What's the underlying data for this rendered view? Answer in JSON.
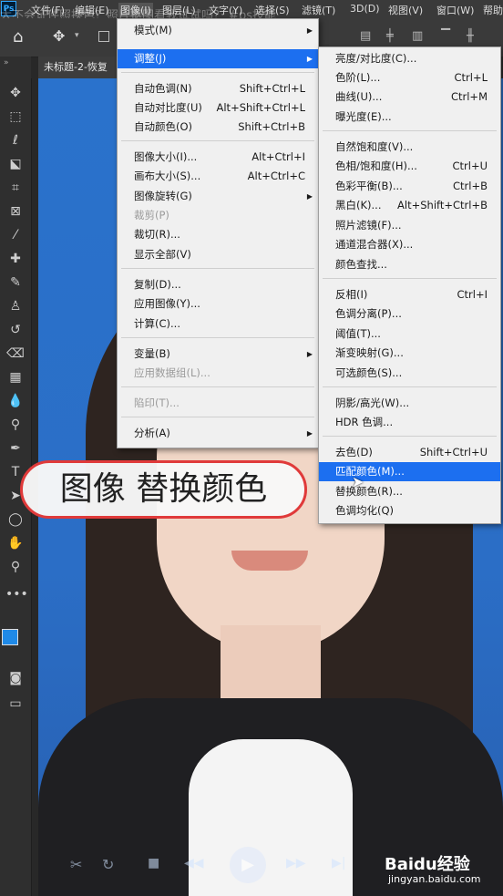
{
  "menubar": {
    "app_logo": "Ps",
    "overlay_caption": "大不会证件照换色？照片抠图看我试试吗？ #ps技能",
    "items": [
      "文件(F)",
      "编辑(E)",
      "图像(I)",
      "图层(L)",
      "文字(Y)",
      "选择(S)",
      "滤镜(T)",
      "3D(D)",
      "视图(V)",
      "窗口(W)",
      "帮助"
    ]
  },
  "tab": {
    "label": "未标题-2-恢复"
  },
  "image_menu": {
    "items": [
      {
        "label": "模式(M)",
        "shortcut": "",
        "submenu": true
      },
      {
        "label": "调整(J)",
        "shortcut": "",
        "submenu": true,
        "highlight": true
      },
      {
        "label": "自动色调(N)",
        "shortcut": "Shift+Ctrl+L"
      },
      {
        "label": "自动对比度(U)",
        "shortcut": "Alt+Shift+Ctrl+L"
      },
      {
        "label": "自动颜色(O)",
        "shortcut": "Shift+Ctrl+B"
      },
      {
        "label": "图像大小(I)...",
        "shortcut": "Alt+Ctrl+I"
      },
      {
        "label": "画布大小(S)...",
        "shortcut": "Alt+Ctrl+C"
      },
      {
        "label": "图像旋转(G)",
        "shortcut": "",
        "submenu": true
      },
      {
        "label": "裁剪(P)",
        "shortcut": "",
        "disabled": true
      },
      {
        "label": "裁切(R)...",
        "shortcut": ""
      },
      {
        "label": "显示全部(V)",
        "shortcut": ""
      },
      {
        "label": "复制(D)...",
        "shortcut": ""
      },
      {
        "label": "应用图像(Y)...",
        "shortcut": ""
      },
      {
        "label": "计算(C)...",
        "shortcut": ""
      },
      {
        "label": "变量(B)",
        "shortcut": "",
        "submenu": true
      },
      {
        "label": "应用数据组(L)...",
        "shortcut": "",
        "disabled": true
      },
      {
        "label": "陷印(T)...",
        "shortcut": "",
        "disabled": true
      },
      {
        "label": "分析(A)",
        "shortcut": "",
        "submenu": true
      }
    ]
  },
  "adjust_menu": {
    "items": [
      {
        "label": "亮度/对比度(C)...",
        "shortcut": ""
      },
      {
        "label": "色阶(L)...",
        "shortcut": "Ctrl+L"
      },
      {
        "label": "曲线(U)...",
        "shortcut": "Ctrl+M"
      },
      {
        "label": "曝光度(E)...",
        "shortcut": ""
      },
      {
        "label": "自然饱和度(V)...",
        "shortcut": ""
      },
      {
        "label": "色相/饱和度(H)...",
        "shortcut": "Ctrl+U"
      },
      {
        "label": "色彩平衡(B)...",
        "shortcut": "Ctrl+B"
      },
      {
        "label": "黑白(K)...",
        "shortcut": "Alt+Shift+Ctrl+B"
      },
      {
        "label": "照片滤镜(F)...",
        "shortcut": ""
      },
      {
        "label": "通道混合器(X)...",
        "shortcut": ""
      },
      {
        "label": "颜色查找...",
        "shortcut": ""
      },
      {
        "label": "反相(I)",
        "shortcut": "Ctrl+I"
      },
      {
        "label": "色调分离(P)...",
        "shortcut": ""
      },
      {
        "label": "阈值(T)...",
        "shortcut": ""
      },
      {
        "label": "渐变映射(G)...",
        "shortcut": ""
      },
      {
        "label": "可选颜色(S)...",
        "shortcut": ""
      },
      {
        "label": "阴影/高光(W)...",
        "shortcut": ""
      },
      {
        "label": "HDR 色调...",
        "shortcut": ""
      },
      {
        "label": "去色(D)",
        "shortcut": "Shift+Ctrl+U"
      },
      {
        "label": "匹配颜色(M)...",
        "shortcut": "",
        "highlight": true
      },
      {
        "label": "替换颜色(R)...",
        "shortcut": ""
      },
      {
        "label": "色调均化(Q)",
        "shortcut": ""
      }
    ]
  },
  "bubble": {
    "text": "图像 替换颜色"
  },
  "watermark": {
    "brand": "Baidu经验",
    "url": "jingyan.baidu.com"
  },
  "colors": {
    "menu_highlight": "#1c6ff0",
    "canvas_bg": "#2a72cc",
    "bubble_border": "#e03a3a"
  }
}
